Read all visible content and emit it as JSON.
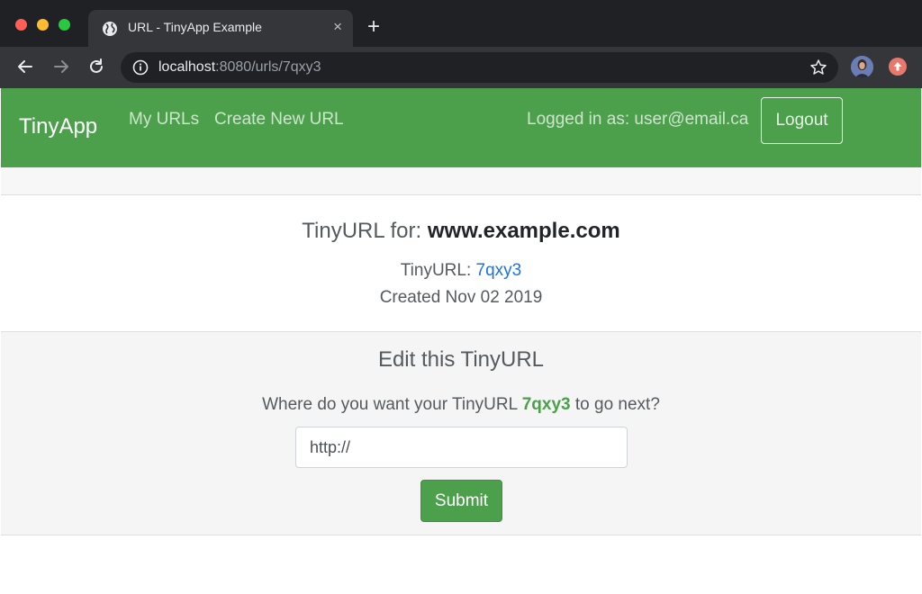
{
  "browser": {
    "tab_title": "URL - TinyApp Example",
    "tab_close": "×",
    "new_tab": "+",
    "url_host": "localhost",
    "url_rest": ":8080/urls/7qxy3"
  },
  "navbar": {
    "brand": "TinyApp",
    "links": [
      "My URLs",
      "Create New URL"
    ],
    "logged_in_text": "Logged in as: user@email.ca",
    "logout_label": "Logout",
    "color": "#4ca04c"
  },
  "url_card": {
    "title_prefix": "TinyURL for: ",
    "long_url": "www.example.com",
    "short_label": "TinyURL: ",
    "short_code": "7qxy3",
    "created": "Created Nov 02 2019"
  },
  "edit": {
    "title": "Edit this TinyURL",
    "question_prefix": "Where do you want your TinyURL ",
    "code": "7qxy3",
    "question_suffix": " to go next?",
    "input_value": "http://",
    "submit_label": "Submit"
  }
}
